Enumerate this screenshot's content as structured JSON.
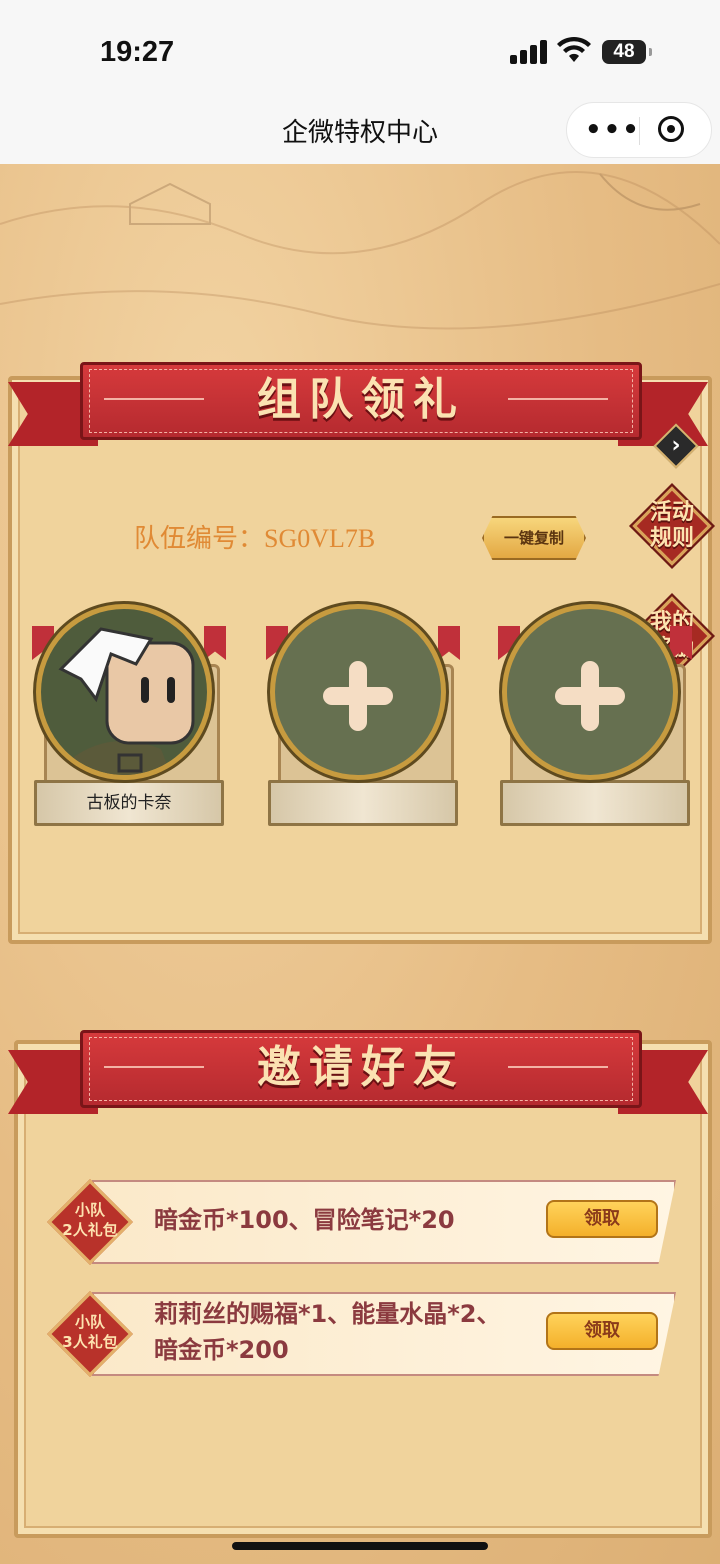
{
  "status_bar": {
    "time": "19:27",
    "battery": "48"
  },
  "nav": {
    "title": "企微特权中心"
  },
  "team_section": {
    "banner": "组队领礼",
    "team_number": "队伍编号：SG0VL7B",
    "copy_button": "一键复制",
    "rules_button": "活动\n规则",
    "rewards_button": "我的\n奖励",
    "members": [
      {
        "name": "古板的卡奈",
        "filled": true
      },
      {
        "name": "",
        "filled": false
      },
      {
        "name": "",
        "filled": false
      }
    ]
  },
  "invite_section": {
    "banner": "邀请好友",
    "rewards": [
      {
        "badge": "小队\n2人礼包",
        "desc": "暗金币*100、冒险笔记*20",
        "button": "领取"
      },
      {
        "badge": "小队\n3人礼包",
        "desc": "莉莉丝的赐福*1、能量水晶*2、暗金币*200",
        "button": "领取"
      }
    ]
  },
  "colors": {
    "banner_red": "#c62f33",
    "text_orange": "#e08a35",
    "desc_color": "#8b3a3f"
  }
}
